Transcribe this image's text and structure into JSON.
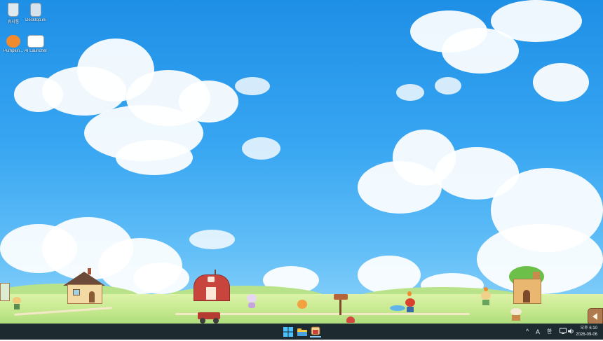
{
  "desktop": {
    "icons": [
      {
        "label": "휴지통",
        "icon": "recycle-bin-icon"
      },
      {
        "label": "Desktop.ini",
        "icon": "file-icon"
      },
      {
        "label": "Pumpkin...",
        "icon": "pumpkin-app-icon"
      },
      {
        "label": "AI Launcher",
        "icon": "settings-app-icon"
      }
    ]
  },
  "taskbar": {
    "apps": [
      {
        "name": "start",
        "icon": "windows-start-icon"
      },
      {
        "name": "file-explorer",
        "icon": "folder-icon"
      },
      {
        "name": "farm-app",
        "icon": "farm-app-icon"
      }
    ],
    "tray": {
      "overflow": "^",
      "input_mode": "A",
      "ime": "한",
      "network_icon": "network-icon",
      "volume_icon": "speaker-icon"
    },
    "clock": {
      "time": "오후 6:10",
      "date": "2026-09-06"
    }
  },
  "scene": {
    "side_tab_icon": "collapse-left-icon"
  },
  "colors": {
    "sky_top": "#1e8fe6",
    "sky_bottom": "#8fd3f9",
    "grass": "#c6e98f",
    "taskbar": "#1d2a30",
    "barn_red": "#c8453e"
  }
}
